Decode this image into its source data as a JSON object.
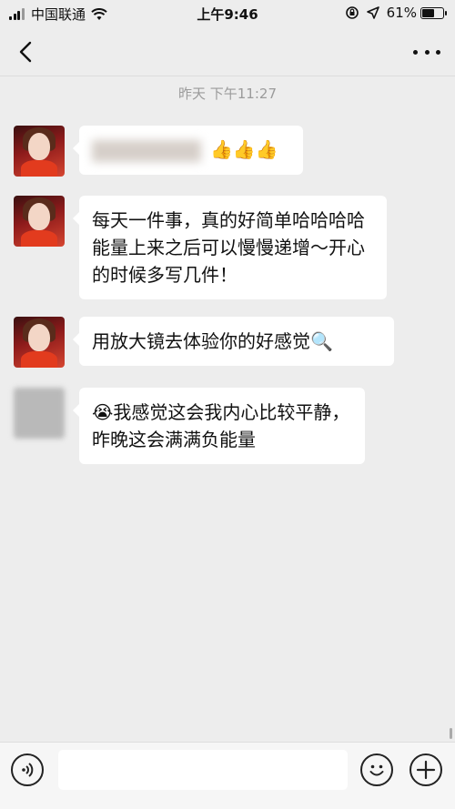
{
  "status_bar": {
    "carrier": "中国联通",
    "time": "上午9:46",
    "battery": "61%",
    "battery_level": 0.61
  },
  "nav": {
    "title": "",
    "back_icon": "chevron-left-icon",
    "more_icon": "more-dots-icon"
  },
  "chat": {
    "timestamp": "昨天 下午11:27",
    "messages": [
      {
        "text": "👍👍👍"
      },
      {
        "text": "每天一件事，真的好简单哈哈哈哈 能量上来之后可以慢慢递增～开心的时候多写几件！"
      },
      {
        "text": "用放大镜去体验你的好感觉🔍"
      },
      {
        "text": "😭我感觉这会我内心比较平静，昨晚这会满满负能量"
      }
    ]
  },
  "input_bar": {
    "voice_icon": "voice-icon",
    "emoji_icon": "emoji-icon",
    "plus_icon": "plus-icon",
    "placeholder": ""
  }
}
